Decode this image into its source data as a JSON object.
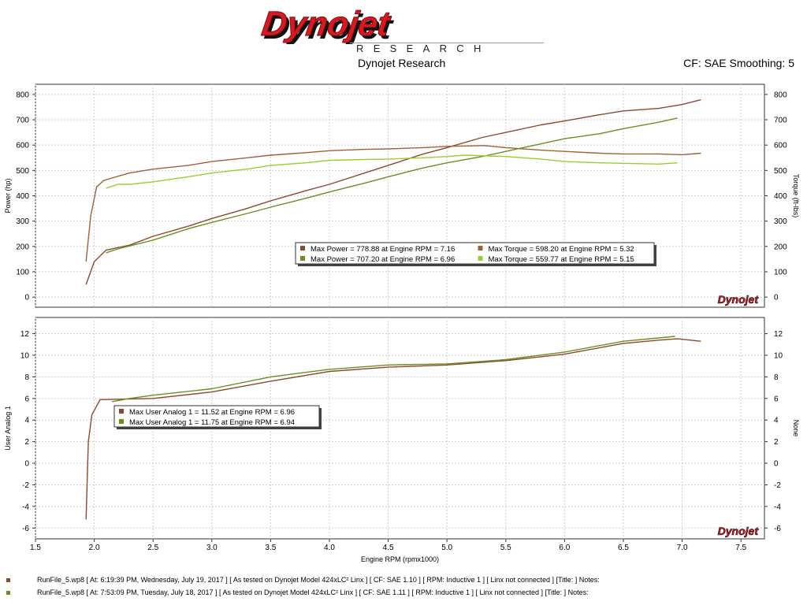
{
  "header": {
    "logo_text": "Dynojet",
    "logo_subtext": "RESEARCH",
    "company": "Dynojet Research",
    "cf_info": "CF: SAE Smoothing: 5"
  },
  "colors": {
    "run1": "#8B4A2B",
    "run1_light": "#A0603A",
    "run2": "#6B8E23",
    "run2_light": "#9ACD32"
  },
  "chart_data": [
    {
      "type": "line",
      "ylabel": "Power (hp)",
      "ylabel_right": "Torque (ft-lbs)",
      "xlim": [
        1.5,
        7.7
      ],
      "ylim": [
        -40,
        840
      ],
      "yticks": [
        "0",
        "100",
        "200",
        "300",
        "400",
        "500",
        "600",
        "700",
        "800"
      ],
      "grid": true,
      "watermark": "Dynojet",
      "series": [
        {
          "name": "Power",
          "color": "#8B4A2B",
          "x": [
            1.93,
            2.0,
            2.1,
            2.3,
            2.5,
            2.8,
            3.0,
            3.3,
            3.5,
            3.8,
            4.0,
            4.3,
            4.5,
            4.8,
            5.0,
            5.3,
            5.5,
            5.8,
            6.0,
            6.3,
            6.5,
            6.8,
            7.0,
            7.16
          ],
          "y": [
            50,
            140,
            185,
            205,
            240,
            280,
            310,
            350,
            380,
            420,
            445,
            490,
            520,
            565,
            590,
            630,
            650,
            680,
            695,
            720,
            735,
            745,
            760,
            779
          ]
        },
        {
          "name": "Torque",
          "color": "#A0603A",
          "x": [
            1.93,
            1.97,
            2.02,
            2.08,
            2.15,
            2.3,
            2.5,
            2.8,
            3.0,
            3.3,
            3.5,
            3.8,
            4.0,
            4.3,
            4.5,
            4.8,
            5.0,
            5.32,
            5.5,
            5.8,
            6.0,
            6.3,
            6.5,
            6.8,
            7.0,
            7.16
          ],
          "y": [
            140,
            320,
            435,
            460,
            470,
            490,
            505,
            520,
            535,
            550,
            560,
            570,
            578,
            583,
            585,
            590,
            595,
            598,
            590,
            580,
            575,
            568,
            565,
            565,
            562,
            568
          ]
        },
        {
          "name": "Power",
          "color": "#6B8E23",
          "x": [
            2.1,
            2.2,
            2.5,
            2.8,
            3.0,
            3.3,
            3.5,
            3.8,
            4.0,
            4.3,
            4.5,
            4.8,
            5.0,
            5.3,
            5.5,
            5.8,
            6.0,
            6.3,
            6.5,
            6.8,
            6.96
          ],
          "y": [
            175,
            190,
            225,
            270,
            295,
            330,
            355,
            390,
            415,
            450,
            475,
            510,
            530,
            555,
            575,
            605,
            625,
            645,
            665,
            690,
            707
          ]
        },
        {
          "name": "Torque",
          "color": "#9ACD32",
          "x": [
            2.1,
            2.2,
            2.3,
            2.5,
            2.8,
            3.0,
            3.3,
            3.5,
            3.8,
            4.0,
            4.3,
            4.5,
            4.8,
            5.0,
            5.15,
            5.5,
            5.8,
            6.0,
            6.3,
            6.5,
            6.8,
            6.96
          ],
          "y": [
            430,
            445,
            445,
            455,
            475,
            490,
            505,
            520,
            530,
            540,
            543,
            545,
            550,
            555,
            560,
            555,
            545,
            535,
            530,
            528,
            525,
            530
          ]
        }
      ],
      "legend": [
        {
          "text": "Max Power = 778.88 at Engine RPM = 7.16",
          "color": "#8B4A2B"
        },
        {
          "text": "Max Torque = 598.20 at Engine RPM = 5.32",
          "color": "#A0603A"
        },
        {
          "text": "Max Power = 707.20 at Engine RPM = 6.96",
          "color": "#6B8E23"
        },
        {
          "text": "Max Torque = 559.77 at Engine RPM = 5.15",
          "color": "#9ACD32"
        }
      ]
    },
    {
      "type": "line",
      "xlabel": "Engine RPM (rpmx1000)",
      "ylabel": "User Analog 1",
      "ylabel_right": "None",
      "xlim": [
        1.5,
        7.7
      ],
      "ylim": [
        -7,
        13.5
      ],
      "xticks": [
        "1.5",
        "2.0",
        "2.5",
        "3.0",
        "3.5",
        "4.0",
        "4.5",
        "5.0",
        "5.5",
        "6.0",
        "6.5",
        "7.0",
        "7.5"
      ],
      "yticks": [
        "-6",
        "-4",
        "-2",
        "0",
        "2",
        "4",
        "6",
        "8",
        "10",
        "12"
      ],
      "grid": true,
      "watermark": "Dynojet",
      "series": [
        {
          "name": "User Analog 1",
          "color": "#8B4A2B",
          "x": [
            1.93,
            1.95,
            1.98,
            2.05,
            2.1,
            2.5,
            3.0,
            3.5,
            4.0,
            4.5,
            5.0,
            5.5,
            6.0,
            6.5,
            6.8,
            6.96,
            7.16
          ],
          "y": [
            -5.2,
            2,
            4.5,
            5.9,
            5.9,
            6.0,
            6.6,
            7.6,
            8.5,
            8.9,
            9.1,
            9.5,
            10.1,
            11.1,
            11.4,
            11.52,
            11.3
          ]
        },
        {
          "name": "User Analog 1",
          "color": "#6B8E23",
          "x": [
            2.15,
            2.3,
            2.5,
            3.0,
            3.5,
            4.0,
            4.5,
            5.0,
            5.5,
            6.0,
            6.5,
            6.8,
            6.94
          ],
          "y": [
            5.7,
            6.0,
            6.3,
            6.9,
            8.0,
            8.7,
            9.1,
            9.2,
            9.6,
            10.3,
            11.3,
            11.6,
            11.75
          ]
        }
      ],
      "legend": [
        {
          "text": "Max User Analog 1 = 11.52 at Engine RPM = 6.96",
          "color": "#8B4A2B"
        },
        {
          "text": "Max User Analog 1 = 11.75 at Engine RPM = 6.94",
          "color": "#6B8E23"
        }
      ]
    }
  ],
  "footer": {
    "runs": [
      {
        "text": "RunFile_5.wp8 [ At: 6:19:39 PM, Wednesday, July 19, 2017 ] [ As tested on Dynojet Model 424xLC² Linx ] [ CF: SAE 1.10 ] [ RPM: Inductive 1 ] [ Linx not connected ] [Title: ]  Notes:",
        "color": "#8B4A2B"
      },
      {
        "text": "RunFile_5.wp8 [ At: 7:53:09 PM, Tuesday, July 18, 2017 ] [ As tested on Dynojet Model 424xLC² Linx ] [ CF: SAE 1.11 ] [ RPM: Inductive 1 ] [ Linx not connected ] [Title: ]  Notes:",
        "color": "#6B8E23"
      }
    ]
  }
}
